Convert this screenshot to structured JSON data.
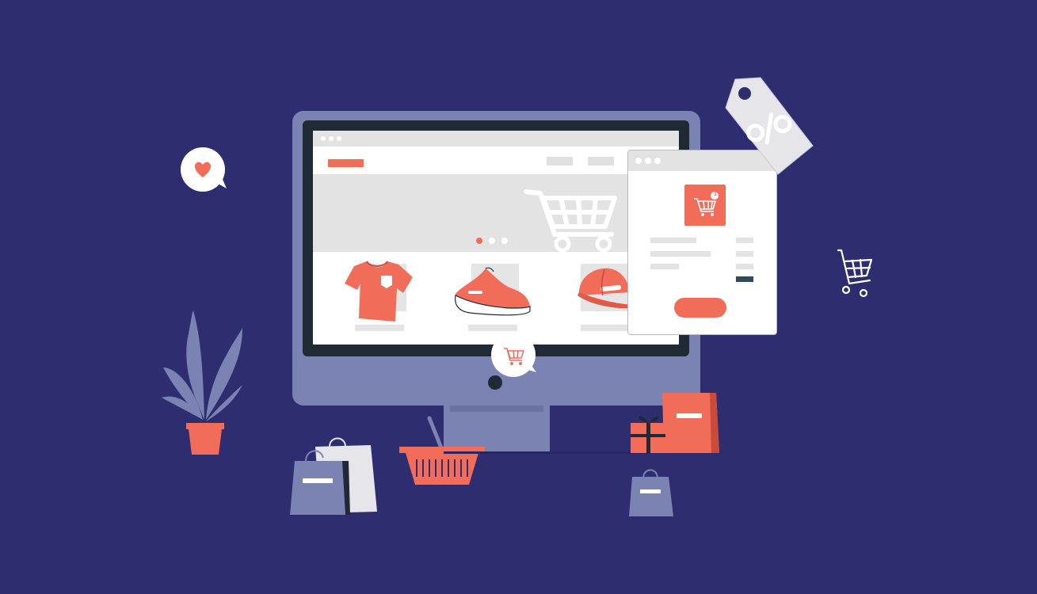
{
  "illustration": {
    "subject": "online-shopping",
    "colors": {
      "background": "#2d2d6f",
      "accent": "#f26c5a",
      "monitor": "#7b83b3",
      "screen_frame": "#1f2a34",
      "light_gray": "#e3e3e3",
      "white": "#ffffff"
    },
    "screen": {
      "products": [
        {
          "icon": "t-shirt-icon"
        },
        {
          "icon": "sneaker-icon"
        },
        {
          "icon": "cap-icon"
        }
      ],
      "slider_dots": 3,
      "active_slide": 1
    },
    "popup": {
      "cart_badge": "1"
    },
    "discount_tag": {
      "symbol": "%"
    }
  }
}
